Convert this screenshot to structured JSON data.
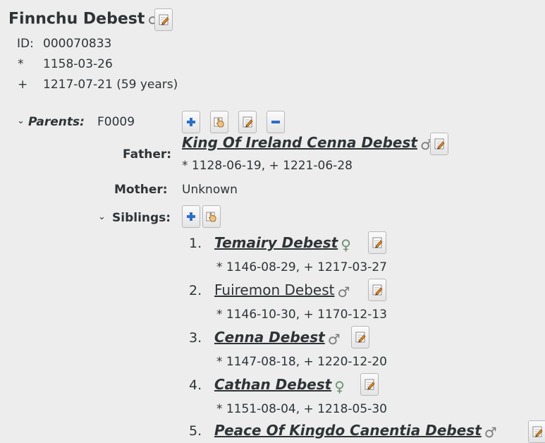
{
  "person": {
    "name": "Finnchu Debest",
    "gender_symbol": "♂",
    "id_label": "ID:",
    "id_value": "000070833",
    "birth_symbol": "*",
    "birth_date": "1158-03-26",
    "death_symbol": "+",
    "death_date": "1217-07-21 (59 years)"
  },
  "parents": {
    "label": "Parents:",
    "family_id": "F0009",
    "father_label": "Father:",
    "father_name": "King Of Ireland Cenna Debest",
    "father_symbol": "♂",
    "father_dates": "* 1128-06-19, + 1221-06-28",
    "mother_label": "Mother:",
    "mother_value": "Unknown",
    "siblings_label": "Siblings:"
  },
  "siblings": [
    {
      "num": "1.",
      "name": "Temairy Debest",
      "symbol": "♀",
      "dates": "* 1146-08-29, + 1217-03-27"
    },
    {
      "num": "2.",
      "name": "Fuiremon Debest",
      "symbol": "♂",
      "dates": "* 1146-10-30, + 1170-12-13"
    },
    {
      "num": "3.",
      "name": "Cenna Debest",
      "symbol": "♂",
      "dates": "* 1147-08-18, + 1220-12-20"
    },
    {
      "num": "4.",
      "name": "Cathan Debest",
      "symbol": "♀",
      "dates": "* 1151-08-04, + 1218-05-30"
    },
    {
      "num": "5.",
      "name": "Peace Of Kingdo Canentia Debest",
      "symbol": "♂"
    }
  ],
  "colors": {
    "background": "#ededed",
    "text": "#2e3436",
    "add_blue": "#2a6fc9",
    "edit_orange": "#e08a1e"
  }
}
